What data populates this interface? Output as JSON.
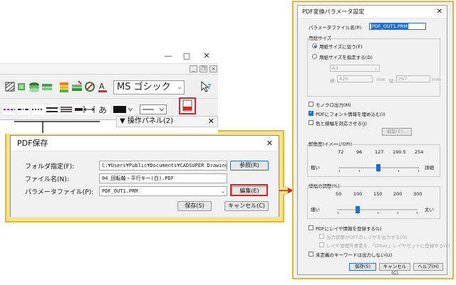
{
  "cad_window": {
    "controls": {
      "minimize": "—",
      "maximize": "□",
      "close": "✕"
    },
    "font_combo_value": "MS ゴシック",
    "panel_title": "操作パネル(2)",
    "panel_close": "✕"
  },
  "pdf_save": {
    "title": "PDF保存",
    "close": "✕",
    "folder_label": "フォルダ指定(F):",
    "folder_value": "C:¥Users¥Public¥Documents¥CADSUPER Drawing",
    "browse_label": "参照(R)",
    "filename_label": "ファイル名(N):",
    "filename_value": "04_回転軸・平行キー(白).PDF",
    "param_label": "パラメータファイル(P):",
    "param_value": "PDF_OUT1.PRM",
    "edit_label": "編集(E)",
    "save_label": "保存(S)",
    "cancel_label": "キャンセル(C)"
  },
  "param_dialog": {
    "title": "PDF変換パラメータ設定",
    "close": "✕",
    "file_label": "パラメータファイル名(P):",
    "file_value": "PDF_OUT1.PRM",
    "paper_group": "用紙サイズ",
    "radio_follow": "用紙サイズに従う(F)",
    "radio_specify": "用紙サイズを指定する(D)",
    "paper_size": "A3",
    "width_label": "横:",
    "width_value": "420",
    "height_label": "縦:",
    "height_value": "297",
    "unit_mm": "mm",
    "check_monochrome": "モノクロ出力(M)",
    "check_embed_font": "PDFにフォント情報を埋め込む(I)",
    "check_color_width": "色と線幅を対応させる(J)",
    "edit_button": "編集(E)...",
    "resolution_group": "解像度(イメージDPI)",
    "resolution_ticks": [
      "72",
      "96",
      "127",
      "190.5",
      "254"
    ],
    "resolution_left": "粗い",
    "resolution_right": "詳細",
    "resolution_value": "127",
    "thickness_group": "線幅の調整(%)",
    "thickness_ticks": [
      "50",
      "100",
      "150",
      "200",
      "300"
    ],
    "thickness_left": "細い",
    "thickness_right": "太い",
    "thickness_value": "100",
    "check_layer": "PDFにレイヤ情報を登録する(L)",
    "check_off_layer": "出力状態がOFFのレイヤを出力する(O)",
    "check_other_layer": "レイヤ管理外要素を、「Other」レイヤセットに登録する(Y)",
    "check_undefined_keyword": "未定義のキーワードは出力しない(U)",
    "save_label": "保存(S)",
    "cancel_label": "キャンセル(C)",
    "help_label": "ヘルプ(H)"
  },
  "colors": {
    "highlight_fill": "#f8e38a",
    "highlight_border": "#e0b83a",
    "callout_red": "#d9242a",
    "accent_blue": "#1d6fd8"
  }
}
